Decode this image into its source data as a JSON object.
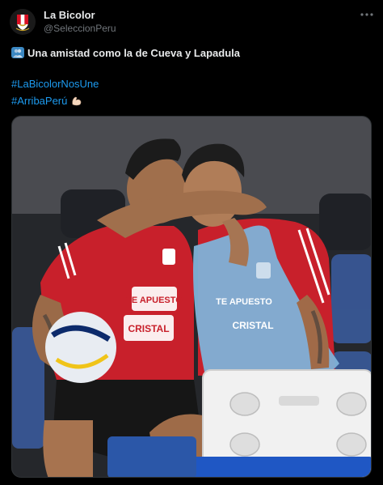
{
  "account": {
    "name": "La Bicolor",
    "handle": "@SeleccionPeru",
    "avatar_icon": "peru-federation-crest-icon"
  },
  "menu": {
    "icon": "more-horizontal-icon"
  },
  "tweet": {
    "text": "Una amistad como la de Cueva y Lapadula",
    "text_emoji": "people-hugging-emoji",
    "hashtags": [
      "#LaBicolorNosUne",
      "#ArribaPerú"
    ],
    "hashtag_emoji": "flexed-biceps-emoji",
    "hashtag_color": "#1d9bf0"
  },
  "media": {
    "jersey_left_text": [
      "TE APUESTO",
      "CRISTAL"
    ],
    "jersey_right_text": [
      "TE APUESTO",
      "CRISTAL"
    ],
    "colors": {
      "jersey_red": "#c8202b",
      "bib_blue": "#7fb2d8",
      "background": "#2a2b2e"
    }
  }
}
